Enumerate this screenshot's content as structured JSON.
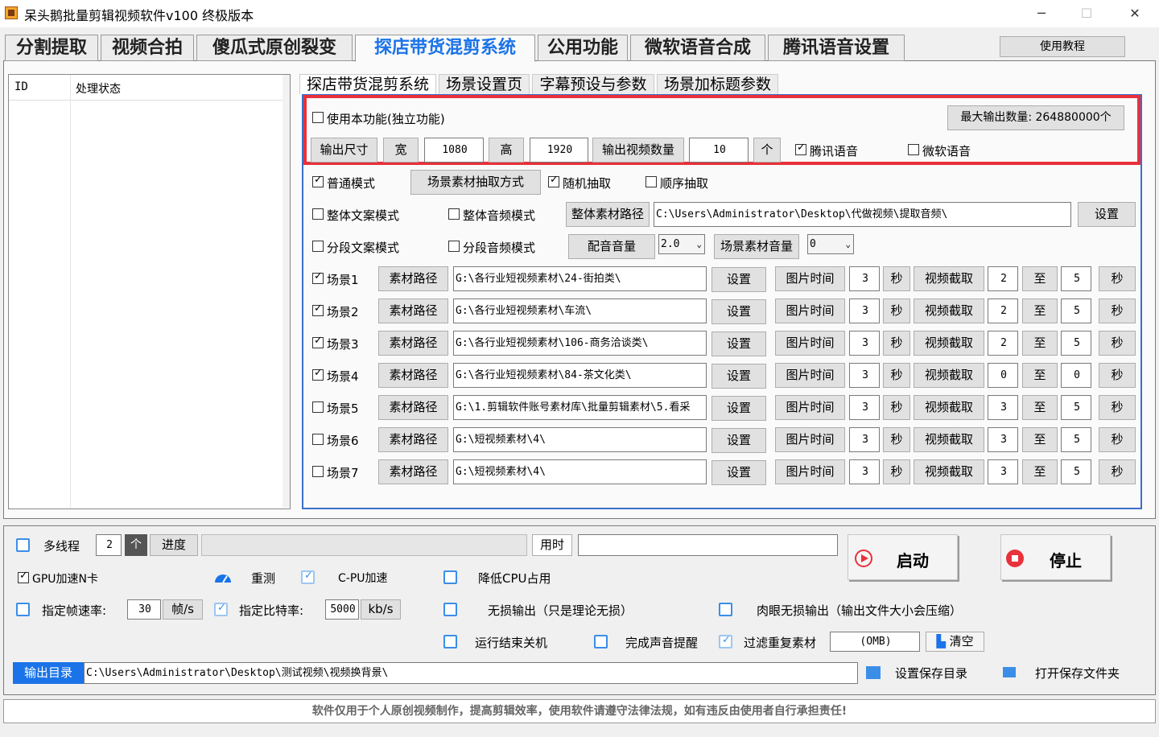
{
  "window": {
    "title": "呆头鹅批量剪辑视频软件v100 终极版本",
    "minimize": "─",
    "maximize": "☐",
    "close": "✕"
  },
  "main_tabs": [
    "分割提取",
    "视频合拍",
    "傻瓜式原创裂变",
    "探店带货混剪系统",
    "公用功能",
    "微软语音合成",
    "腾讯语音设置"
  ],
  "tutorial_button": "使用教程",
  "status_table": {
    "headers": [
      "ID",
      "处理状态"
    ]
  },
  "sub_tabs": [
    "探店带货混剪系统",
    "场景设置页",
    "字幕预设与参数",
    "场景加标题参数"
  ],
  "options": {
    "use_this": "使用本功能(独立功能)",
    "max_output": "最大输出数量: 264880000个",
    "output_size": "输出尺寸",
    "width_label": "宽",
    "width": "1080",
    "height_label": "高",
    "height": "1920",
    "count_label": "输出视频数量",
    "count": "10",
    "unit": "个",
    "tencent_voice": "腾讯语音",
    "ms_voice": "微软语音",
    "normal_mode": "普通模式",
    "scene_extract": "场景素材抽取方式",
    "random": "随机抽取",
    "sequential": "顺序抽取",
    "whole_text": "整体文案模式",
    "whole_audio": "整体音频模式",
    "whole_path_btn": "整体素材路径",
    "whole_path": "C:\\Users\\Administrator\\Desktop\\代做视频\\提取音频\\",
    "set": "设置",
    "seg_text": "分段文案模式",
    "seg_audio": "分段音频模式",
    "dub_volume": "配音音量",
    "dub_value": "2.0",
    "scene_volume": "场景素材音量",
    "scene_value": "0"
  },
  "scene_labels": {
    "path_btn": "素材路径",
    "set": "设置",
    "pic_time": "图片时间",
    "sec": "秒",
    "clip": "视频截取",
    "to": "至"
  },
  "scenes": [
    {
      "name": "场景1",
      "checked": true,
      "path": "G:\\各行业短视频素材\\24-街拍类\\",
      "pic": "3",
      "from": "2",
      "to": "5"
    },
    {
      "name": "场景2",
      "checked": true,
      "path": "G:\\各行业短视频素材\\车流\\",
      "pic": "3",
      "from": "2",
      "to": "5"
    },
    {
      "name": "场景3",
      "checked": true,
      "path": "G:\\各行业短视频素材\\106-商务洽谈类\\",
      "pic": "3",
      "from": "2",
      "to": "5"
    },
    {
      "name": "场景4",
      "checked": true,
      "path": "G:\\各行业短视频素材\\84-茶文化类\\",
      "pic": "3",
      "from": "0",
      "to": "0"
    },
    {
      "name": "场景5",
      "checked": false,
      "path": "G:\\1.剪辑软件账号素材库\\批量剪辑素材\\5.看采",
      "pic": "3",
      "from": "3",
      "to": "5"
    },
    {
      "name": "场景6",
      "checked": false,
      "path": "G:\\短视频素材\\4\\",
      "pic": "3",
      "from": "3",
      "to": "5"
    },
    {
      "name": "场景7",
      "checked": false,
      "path": "G:\\短视频素材\\4\\",
      "pic": "3",
      "from": "3",
      "to": "5"
    }
  ],
  "bottom": {
    "multithread": "多线程",
    "threads": "2",
    "unit": "个",
    "progress": "进度",
    "elapsed": "用时",
    "start": "启动",
    "stop": "停止",
    "gpu": "GPU加速N卡",
    "retest": "重测",
    "cpu_accel": "C-PU加速",
    "reduce_cpu": "降低CPU占用",
    "fps_label": "指定帧速率:",
    "fps": "30",
    "fps_unit": "帧/s",
    "bitrate_label": "指定比特率:",
    "bitrate": "5000",
    "bitrate_unit": "kb/s",
    "lossless": "无损输出（只是理论无损）",
    "visual_lossless": "肉眼无损输出（输出文件大小会压缩）",
    "shutdown": "运行结束关机",
    "sound": "完成声音提醒",
    "filter_dup": "过滤重复素材",
    "dup_size": "(OMB)",
    "clear": "清空",
    "out_dir_label": "输出目录",
    "out_dir": "C:\\Users\\Administrator\\Desktop\\测试视频\\视频换背景\\",
    "set_dir": "设置保存目录",
    "open_dir": "打开保存文件夹"
  },
  "footer": "软件仅用于个人原创视频制作，提高剪辑效率，使用软件请遵守法律法规，如有违反由使用者自行承担责任!",
  "colors": {
    "active_tab": "#1a73e8",
    "highlight": "#e8313a",
    "accent": "#3b8ee8"
  }
}
